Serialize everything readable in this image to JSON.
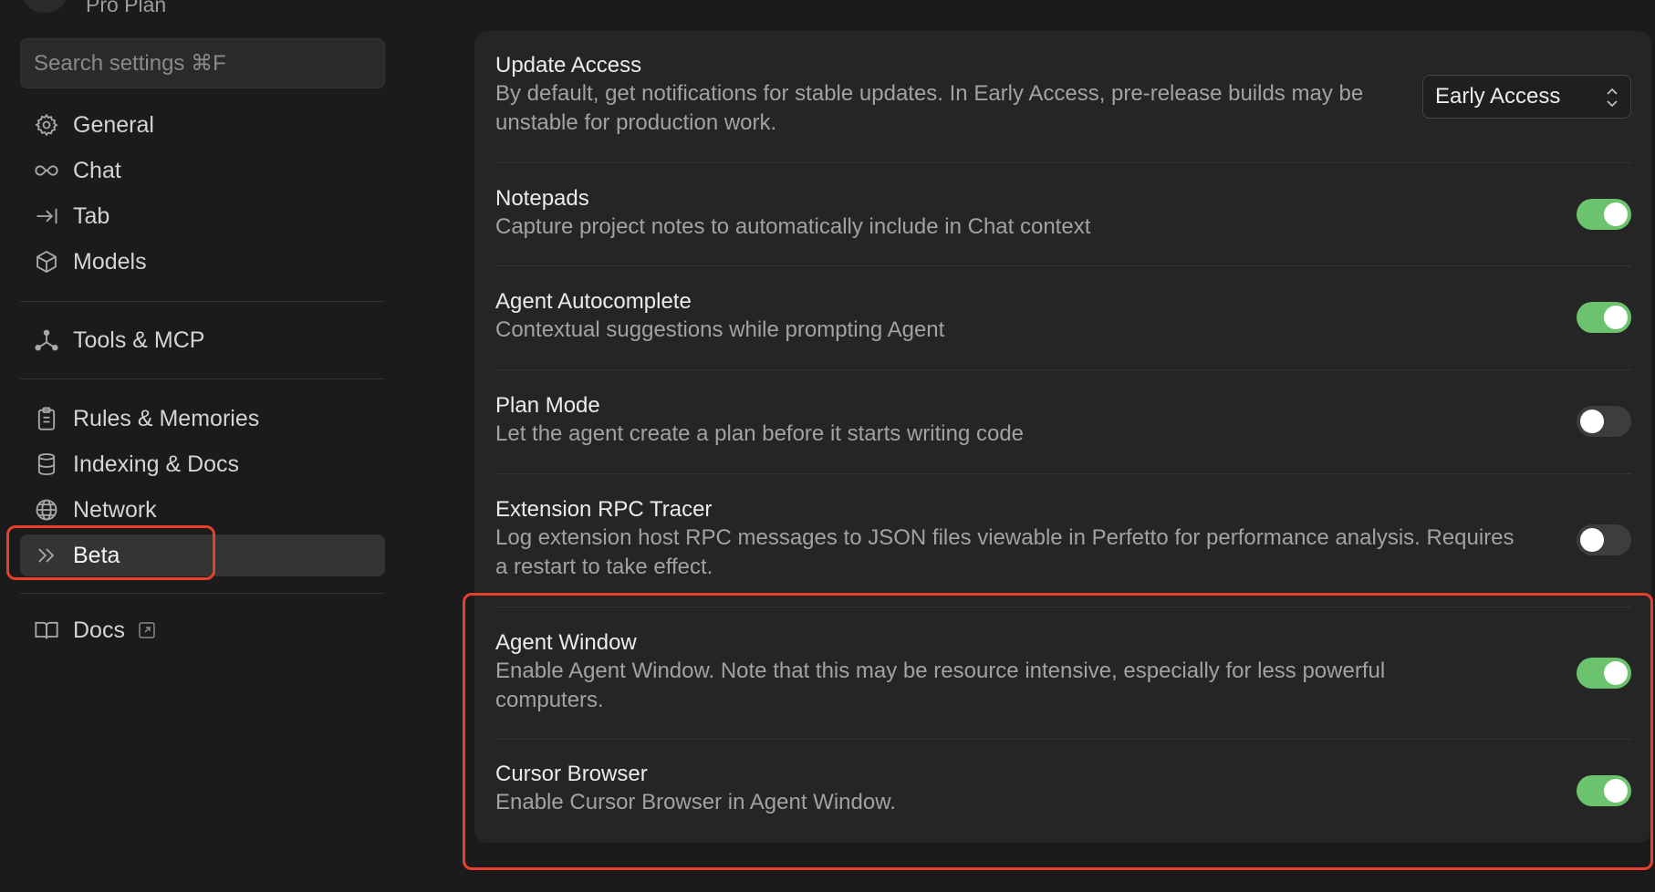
{
  "sidebar": {
    "plan_label": "Pro Plan",
    "search_placeholder": "Search settings ⌘F",
    "items": [
      {
        "label": "General",
        "icon": "gear-icon"
      },
      {
        "label": "Chat",
        "icon": "infinity-icon"
      },
      {
        "label": "Tab",
        "icon": "arrow-to-line-icon"
      },
      {
        "label": "Models",
        "icon": "cube-icon"
      },
      {
        "label": "Tools & MCP",
        "icon": "nodes-icon"
      },
      {
        "label": "Rules & Memories",
        "icon": "clipboard-icon"
      },
      {
        "label": "Indexing & Docs",
        "icon": "database-icon"
      },
      {
        "label": "Network",
        "icon": "globe-icon"
      },
      {
        "label": "Beta",
        "icon": "double-chevron-icon",
        "active": true
      },
      {
        "label": "Docs",
        "icon": "book-icon",
        "external": true
      }
    ]
  },
  "settings": [
    {
      "title": "Update Access",
      "description": "By default, get notifications for stable updates. In Early Access, pre-release builds may be unstable for production work.",
      "control": "select",
      "value": "Early Access"
    },
    {
      "title": "Notepads",
      "description": "Capture project notes to automatically include in Chat context",
      "control": "toggle",
      "enabled": true
    },
    {
      "title": "Agent Autocomplete",
      "description": "Contextual suggestions while prompting Agent",
      "control": "toggle",
      "enabled": true
    },
    {
      "title": "Plan Mode",
      "description": "Let the agent create a plan before it starts writing code",
      "control": "toggle",
      "enabled": false
    },
    {
      "title": "Extension RPC Tracer",
      "description": "Log extension host RPC messages to JSON files viewable in Perfetto for performance analysis. Requires a restart to take effect.",
      "control": "toggle",
      "enabled": false
    },
    {
      "title": "Agent Window",
      "description": "Enable Agent Window. Note that this may be resource intensive, especially for less powerful computers.",
      "control": "toggle",
      "enabled": true
    },
    {
      "title": "Cursor Browser",
      "description": "Enable Cursor Browser in Agent Window.",
      "control": "toggle",
      "enabled": true
    }
  ],
  "colors": {
    "background": "#1b1b1b",
    "panel": "#252525",
    "toggle_on": "#6cc36d",
    "toggle_off": "#3d3d3d",
    "highlight": "#e8402f"
  }
}
